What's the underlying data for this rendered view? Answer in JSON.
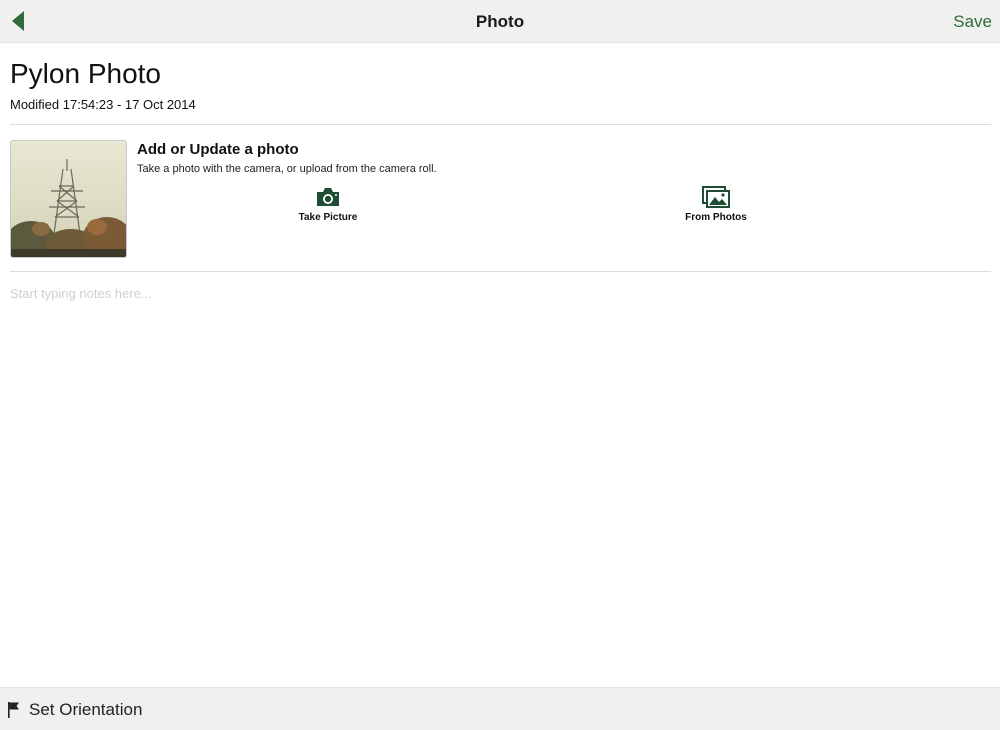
{
  "navbar": {
    "title": "Photo",
    "back_icon": "chevron-left-icon",
    "save_label": "Save"
  },
  "record": {
    "title": "Pylon Photo",
    "modified": "Modified 17:54:23 - 17 Oct 2014"
  },
  "photo_section": {
    "heading": "Add or Update a photo",
    "description": "Take a photo with the camera, or upload from the camera roll.",
    "take_picture_label": "Take Picture",
    "take_picture_icon": "camera-icon",
    "from_photos_label": "From Photos",
    "from_photos_icon": "photos-icon"
  },
  "notes": {
    "placeholder": "Start typing notes here...",
    "value": ""
  },
  "bottombar": {
    "orientation_label": "Set  Orientation",
    "orientation_icon": "flag-icon"
  },
  "colors": {
    "accent": "#2e6b3e",
    "icon_dark": "#1f4d33",
    "bar_bg": "#f0f0ee"
  }
}
